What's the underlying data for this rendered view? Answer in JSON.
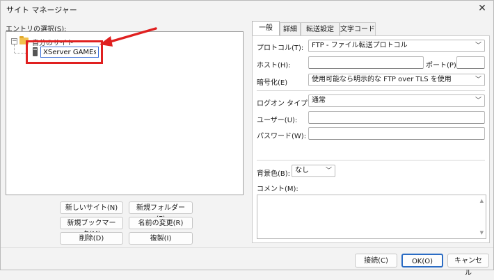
{
  "window": {
    "title": "サイト マネージャー",
    "close_glyph": "✕"
  },
  "left": {
    "entry_label": "エントリの選択(S):",
    "tree": {
      "folder_label": "自分のサイト",
      "expander": "−",
      "rename_value": "XServer GAMEs"
    },
    "buttons": {
      "new_site": "新しいサイト(N)",
      "new_folder": "新規フォルダー(F)",
      "new_bookmark": "新規ブックマーク(M)",
      "rename": "名前の変更(R)",
      "delete": "削除(D)",
      "duplicate": "複製(I)"
    }
  },
  "tabs": [
    "一般",
    "詳細",
    "転送設定",
    "文字コード"
  ],
  "general": {
    "protocol_label": "プロトコル(T):",
    "protocol_value": "FTP - ファイル転送プロトコル",
    "host_label": "ホスト(H):",
    "host_value": "",
    "port_label": "ポート(P):",
    "port_value": "",
    "encryption_label": "暗号化(E)",
    "encryption_value": "使用可能なら明示的な FTP over TLS を使用",
    "logon_label": "ログオン タイプ(L):",
    "logon_value": "通常",
    "user_label": "ユーザー(U):",
    "user_value": "",
    "password_label": "パスワード(W):",
    "password_value": "",
    "bgcolor_label": "背景色(B):",
    "bgcolor_value": "なし",
    "comment_label": "コメント(M):",
    "comment_value": ""
  },
  "footer": {
    "connect": "接続(C)",
    "ok": "OK(O)",
    "cancel": "キャンセル"
  },
  "colors": {
    "annotation": "#e02020",
    "selection_border": "#3a6fd8"
  },
  "icons": [
    "close-icon",
    "folder-icon",
    "server-icon",
    "chevron-down-icon",
    "annotation-arrow-icon"
  ]
}
